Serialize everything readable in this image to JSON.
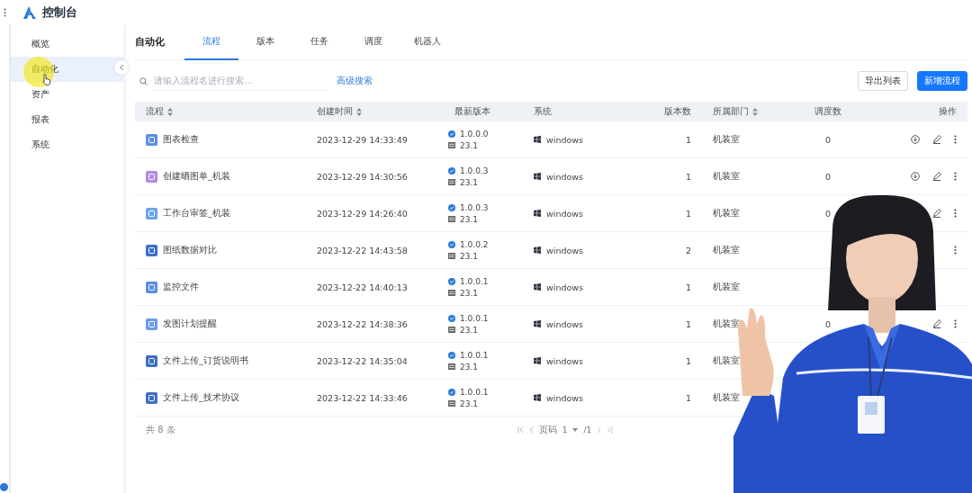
{
  "app": {
    "title": "控制台"
  },
  "sidebar": {
    "items": [
      {
        "label": "概览",
        "selected": false
      },
      {
        "label": "自动化",
        "selected": true
      },
      {
        "label": "资产",
        "selected": false
      },
      {
        "label": "报表",
        "selected": false
      },
      {
        "label": "系统",
        "selected": false
      }
    ]
  },
  "page": {
    "title": "自动化",
    "tabs": [
      {
        "label": "流程",
        "selected": true
      },
      {
        "label": "版本",
        "selected": false
      },
      {
        "label": "任务",
        "selected": false
      },
      {
        "label": "调度",
        "selected": false
      },
      {
        "label": "机器人",
        "selected": false
      }
    ]
  },
  "search": {
    "placeholder": "请输入流程名进行搜索...",
    "advanced_link": "高级搜索"
  },
  "buttons": [
    {
      "label": "导出列表",
      "kind": "secondary"
    },
    {
      "label": "新增流程",
      "kind": "primary"
    }
  ],
  "table": {
    "columns": [
      {
        "label": "流程",
        "sortable": true
      },
      {
        "label": "创建时间",
        "sortable": true
      },
      {
        "label": "最新版本",
        "sortable": false
      },
      {
        "label": "系统",
        "sortable": false
      },
      {
        "label": "版本数",
        "sortable": false
      },
      {
        "label": "所属部门",
        "sortable": true
      },
      {
        "label": "调度数",
        "sortable": false
      },
      {
        "label": "操作",
        "sortable": false
      }
    ],
    "rows": [
      {
        "name": "图表检查",
        "color": "#5b8fe0",
        "created": "2023-12-29 14:33:49",
        "version": "1.0.0.0",
        "build": "23.1",
        "system": "windows",
        "versions": "1",
        "dept": "机装室",
        "dispatch": "0",
        "actions": [
          {
            "kind": "download"
          },
          {
            "kind": "edit"
          },
          {
            "kind": "more"
          }
        ]
      },
      {
        "name": "创建晒图单_机装",
        "color": "#b48ae0",
        "created": "2023-12-29 14:30:56",
        "version": "1.0.0.3",
        "build": "23.1",
        "system": "windows",
        "versions": "1",
        "dept": "机装室",
        "dispatch": "0",
        "actions": [
          {
            "kind": "download"
          },
          {
            "kind": "edit"
          },
          {
            "kind": "more"
          }
        ]
      },
      {
        "name": "工作台审签_机装",
        "color": "#6aa5e8",
        "created": "2023-12-29 14:26:40",
        "version": "1.0.0.3",
        "build": "23.1",
        "system": "windows",
        "versions": "1",
        "dept": "机装室",
        "dispatch": "0",
        "actions": [
          {
            "kind": "edit"
          },
          {
            "kind": "more"
          }
        ]
      },
      {
        "name": "图纸数据对比",
        "color": "#3d6fc4",
        "created": "2023-12-22 14:43:58",
        "version": "1.0.0.2",
        "build": "23.1",
        "system": "windows",
        "versions": "2",
        "dept": "机装室",
        "actions": [
          {
            "kind": "more"
          }
        ]
      },
      {
        "name": "监控文件",
        "color": "#5b8fe0",
        "created": "2023-12-22 14:40:13",
        "version": "1.0.0.1",
        "build": "23.1",
        "system": "windows",
        "versions": "1",
        "dept": "机装室",
        "actions": []
      },
      {
        "name": "发图计划提醒",
        "color": "#6b9be8",
        "created": "2023-12-22 14:38:36",
        "version": "1.0.0.1",
        "build": "23.1",
        "system": "windows",
        "versions": "1",
        "dept": "机装室",
        "dispatch": "0",
        "actions": [
          {
            "kind": "edit"
          },
          {
            "kind": "more"
          }
        ]
      },
      {
        "name": "文件上传_订货说明书",
        "color": "#3d6fc4",
        "created": "2023-12-22 14:35:04",
        "version": "1.0.0.1",
        "build": "23.1",
        "system": "windows",
        "versions": "1",
        "dept": "机装室",
        "actions": []
      },
      {
        "name": "文件上传_技术协议",
        "color": "#3d6fc4",
        "created": "2023-12-22 14:33:46",
        "version": "1.0.0.1",
        "build": "23.1",
        "system": "windows",
        "versions": "1",
        "dept": "机装室",
        "actions": []
      }
    ]
  },
  "footer": {
    "total": "共 8 条",
    "page_label": "页码",
    "page": "1",
    "page_count": "/1"
  }
}
